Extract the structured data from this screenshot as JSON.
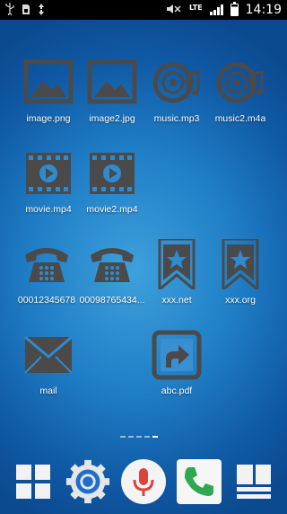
{
  "statusbar": {
    "clock": "14:19",
    "network": "LTE",
    "left_icons": [
      "usb-icon",
      "sim-icon",
      "data-sync-icon"
    ],
    "right_icons": [
      "mute-icon",
      "lte-icon",
      "signal-icon",
      "battery-icon"
    ]
  },
  "icon_color": "#4a4a4a",
  "apps": [
    {
      "label": "image.png",
      "icon": "image-icon"
    },
    {
      "label": "image2.jpg",
      "icon": "image-icon"
    },
    {
      "label": "music.mp3",
      "icon": "music-disc-icon"
    },
    {
      "label": "music2.m4a",
      "icon": "music-disc-icon"
    },
    {
      "label": "movie.mp4",
      "icon": "film-icon"
    },
    {
      "label": "movie2.mp4",
      "icon": "film-icon"
    },
    {
      "label": "00012345678",
      "icon": "telephone-icon"
    },
    {
      "label": "00098765434...",
      "icon": "telephone-icon"
    },
    {
      "label": "xxx.net",
      "icon": "bookmark-icon"
    },
    {
      "label": "xxx.org",
      "icon": "bookmark-icon"
    },
    {
      "label": "mail",
      "icon": "envelope-icon"
    },
    {
      "label": "abc.pdf",
      "icon": "shortcut-arrow-icon"
    }
  ],
  "page_indicator": {
    "pages": 5,
    "active": 5
  },
  "dock": [
    {
      "icon": "apps-grid-icon"
    },
    {
      "icon": "settings-gear-icon"
    },
    {
      "icon": "microphone-icon"
    },
    {
      "icon": "phone-icon"
    },
    {
      "icon": "widgets-icon"
    }
  ]
}
